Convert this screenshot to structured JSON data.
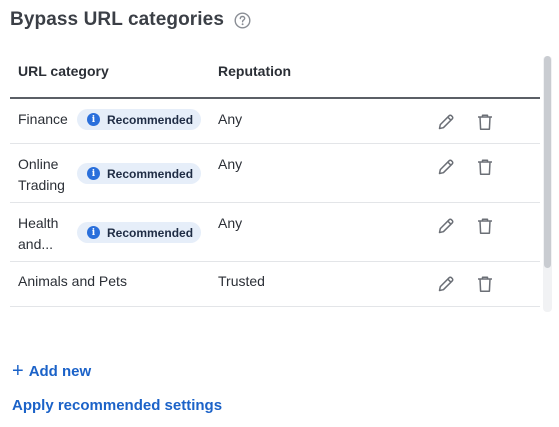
{
  "page": {
    "title": "Bypass URL categories",
    "help_icon": "question-circle-icon"
  },
  "table": {
    "columns": [
      "URL category",
      "Reputation"
    ],
    "rows": [
      {
        "category": "Finance",
        "badge": "Recommended",
        "reputation": "Any"
      },
      {
        "category": "Online Trading",
        "badge": "Recommended",
        "reputation": "Any"
      },
      {
        "category": "Health and...",
        "badge": "Recommended",
        "reputation": "Any"
      },
      {
        "category": "Animals and Pets",
        "badge": "",
        "reputation": "Trusted"
      }
    ],
    "row_actions": [
      "pencil-edit-icon",
      "trash-delete-icon"
    ]
  },
  "actions": {
    "add_new": "Add new",
    "add_icon": "plus-icon",
    "apply_recommended": "Apply recommended settings"
  },
  "colors": {
    "link": "#1b62c8",
    "badge_bg": "#e6eef9",
    "badge_icon": "#2a6fdb"
  }
}
